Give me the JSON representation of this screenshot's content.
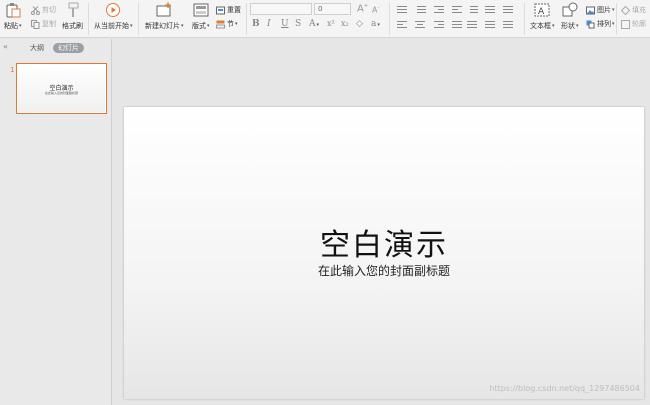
{
  "ribbon": {
    "paste": "粘贴",
    "cut": "剪切",
    "copy": "复制",
    "format_painter": "格式刷",
    "from_current": "从当前开始",
    "new_slide": "新建幻灯片",
    "layout": "版式",
    "reset": "重置",
    "section": "节",
    "font_name": "",
    "font_size": "0",
    "textbox": "文本框",
    "shape": "形状",
    "picture": "图片",
    "arrange": "排列",
    "fill": "填充",
    "outline": "轮廓"
  },
  "panel": {
    "tab_outline": "大纲",
    "tab_slides": "幻灯片",
    "slide_number": "1",
    "thumb_title": "空白演示",
    "thumb_subtitle": "在此输入您的封面副标题"
  },
  "slide": {
    "title": "空白演示",
    "subtitle": "在此输入您的封面副标题"
  },
  "watermark": "https://blog.csdn.net/qq_1297486504",
  "colors": {
    "accent": "#e5762f",
    "ribbon_bg": "#f4f4f4",
    "panel_bg": "#e9e9e9"
  }
}
